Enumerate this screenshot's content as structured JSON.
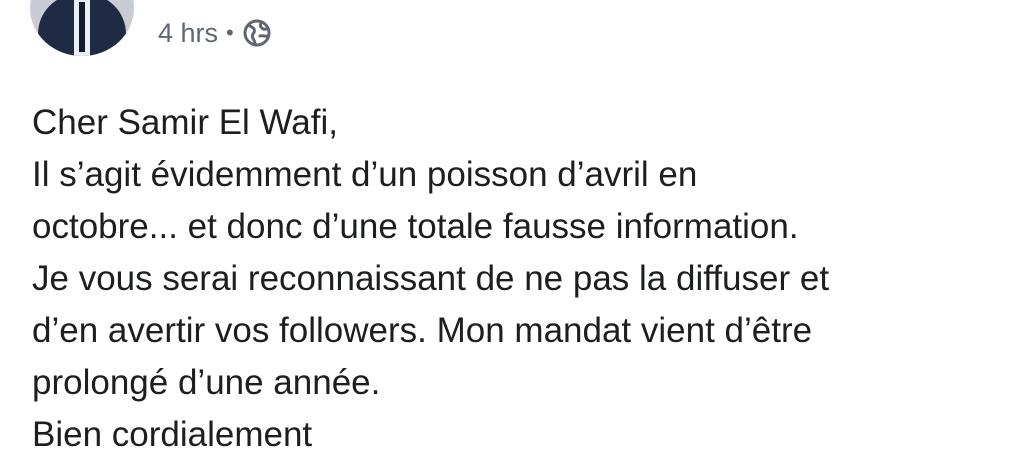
{
  "post": {
    "timestamp": "4 hrs",
    "separator": "•",
    "privacy_icon": "globe-icon",
    "body_lines": [
      "Cher Samir El Wafi,",
      "Il s’agit évidemment d’un poisson d’avril en",
      "octobre... et donc d’une totale fausse information.",
      "Je vous serai reconnaissant de ne pas la diffuser et",
      "d’en avertir vos followers. Mon mandat vient d’être",
      "prolongé d’une année.",
      "Bien cordialement"
    ]
  },
  "colors": {
    "text": "#1c1e21",
    "meta": "#606770",
    "background": "#ffffff"
  }
}
